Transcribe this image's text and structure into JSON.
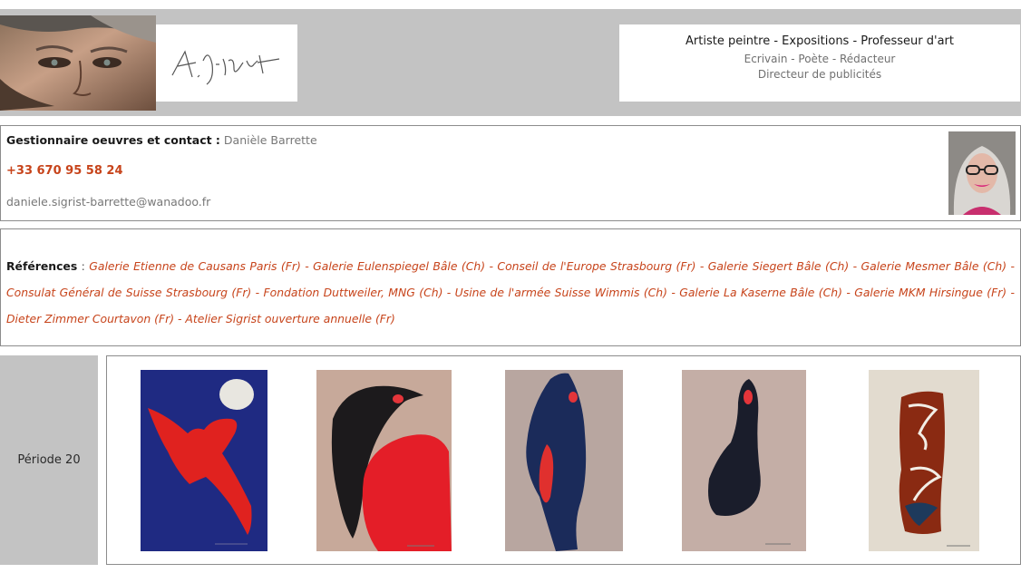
{
  "header": {
    "tagline_main": "Artiste peintre - Expositions - Professeur d'art",
    "tagline_line2": "Ecrivain - Poète - Rédacteur",
    "tagline_line3": "Directeur de publicités",
    "signature_text": "A. Sigrist",
    "colors": {
      "band": "#c3c3c3"
    }
  },
  "contact": {
    "label": "Gestionnaire oeuvres et contact :",
    "name": "Danièle Barrette",
    "phone": "+33 670 95 58 24",
    "email": "daniele.sigrist-barrette@wanadoo.fr",
    "colors": {
      "accent": "#c7441b"
    }
  },
  "references": {
    "label": "Références",
    "separator": " : ",
    "text": "Galerie Etienne de Causans Paris (Fr)  -  Galerie Eulenspiegel Bâle (Ch)  -  Conseil de l'Europe Strasbourg (Fr)  -  Galerie Siegert Bâle (Ch)  -  Galerie Mesmer Bâle (Ch)  -  Consulat Général de Suisse Strasbourg (Fr)  -  Fondation Duttweiler, MNG (Ch)  -  Usine de l'armée Suisse Wimmis (Ch)  -  Galerie La Kaserne Bâle (Ch)  -  Galerie MKM Hirsingue (Fr)  -  Dieter Zimmer Courtavon (Fr)  -  Atelier Sigrist ouverture annuelle (Fr)"
  },
  "gallery": {
    "period_label": "Période 20",
    "artworks": [
      {
        "icon": "red-bird-moon-artwork"
      },
      {
        "icon": "black-red-figure-artwork"
      },
      {
        "icon": "blue-fish-figure-artwork"
      },
      {
        "icon": "dark-figure-artwork"
      },
      {
        "icon": "torn-collage-artwork"
      }
    ]
  }
}
